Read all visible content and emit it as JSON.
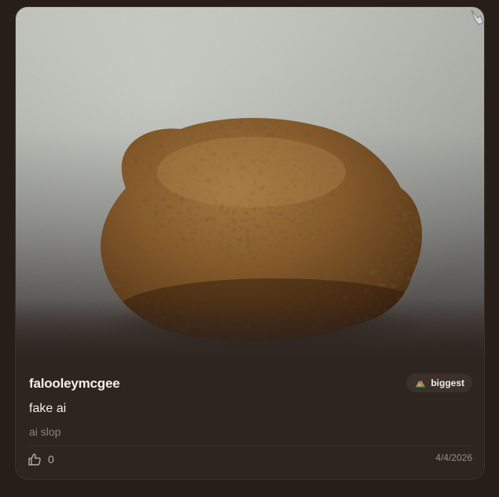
{
  "post": {
    "username": "falooleymcgee",
    "badge": {
      "icon": "pile-icon",
      "label": "biggest"
    },
    "title": "fake ai",
    "description": "ai slop",
    "likes": "0",
    "date": "4/4/2026",
    "image_subject": "cookie"
  },
  "colors": {
    "page_background": "#271d19",
    "card_background": "#2e2420",
    "text_primary": "#f5efe9",
    "text_muted": "#8f817a",
    "badge_background": "#3b302b"
  },
  "icons": {
    "like": "thumbs-up-icon",
    "corner": "hand-pointer-icon"
  }
}
